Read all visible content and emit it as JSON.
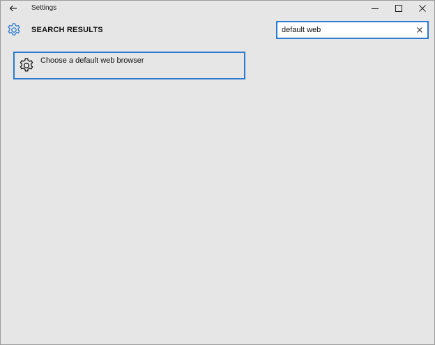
{
  "titlebar": {
    "back_icon": "back-arrow-icon",
    "title": "Settings",
    "controls": [
      "minimize-icon",
      "maximize-icon",
      "close-icon"
    ]
  },
  "header": {
    "icon": "gear-icon",
    "title": "SEARCH RESULTS"
  },
  "search": {
    "value": "default web",
    "clear_icon": "clear-icon"
  },
  "results": [
    {
      "icon": "gear-icon",
      "label": "Choose a default web browser"
    }
  ],
  "colors": {
    "background": "#e6e6e6",
    "accent": "#2b7bd0",
    "text": "#111111"
  }
}
